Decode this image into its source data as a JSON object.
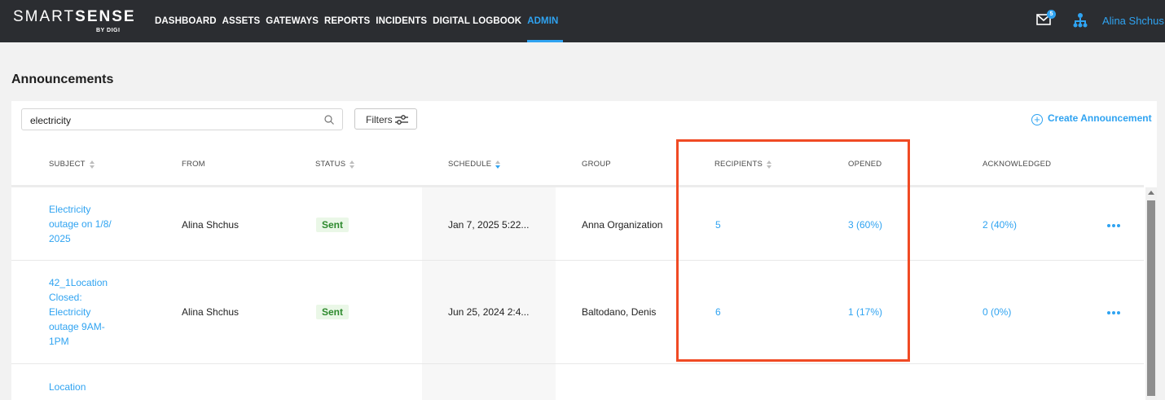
{
  "header": {
    "logo_main_light": "SMART",
    "logo_main_bold": "SENSE",
    "logo_sub": "BY DIGI",
    "nav": [
      "DASHBOARD",
      "ASSETS",
      "GATEWAYS",
      "REPORTS",
      "INCIDENTS",
      "DIGITAL LOGBOOK",
      "ADMIN"
    ],
    "active_nav": "ADMIN",
    "mail_badge": "5",
    "user_name": "Alina Shchus"
  },
  "page": {
    "title": "Announcements"
  },
  "toolbar": {
    "search_value": "electricity",
    "filters_label": "Filters",
    "create_label": "Create Announcement"
  },
  "table": {
    "columns": [
      "SUBJECT",
      "FROM",
      "STATUS",
      "SCHEDULE",
      "GROUP",
      "RECIPIENTS",
      "OPENED",
      "ACKNOWLEDGED"
    ],
    "rows": [
      {
        "subject_lines": [
          "Electricity",
          "outage on 1/8/",
          "2025"
        ],
        "from": "Alina Shchus",
        "status": "Sent",
        "schedule": "Jan 7, 2025 5:22...",
        "group": "Anna Organization",
        "recipients": "5",
        "opened": "3 (60%)",
        "acknowledged": "2 (40%)"
      },
      {
        "subject_lines": [
          "42_1Location",
          "Closed:",
          "Electricity",
          "outage 9AM-",
          "1PM"
        ],
        "from": "Alina Shchus",
        "status": "Sent",
        "schedule": "Jun 25, 2024 2:4...",
        "group": "Baltodano, Denis",
        "recipients": "6",
        "opened": "1 (17%)",
        "acknowledged": "0 (0%)"
      },
      {
        "subject_lines": [
          "Location"
        ]
      }
    ]
  },
  "colors": {
    "accent": "#2fa3f1",
    "highlight": "#f04a24",
    "nav_bg": "#2b2d31",
    "status_green": "#2d8a2d"
  }
}
